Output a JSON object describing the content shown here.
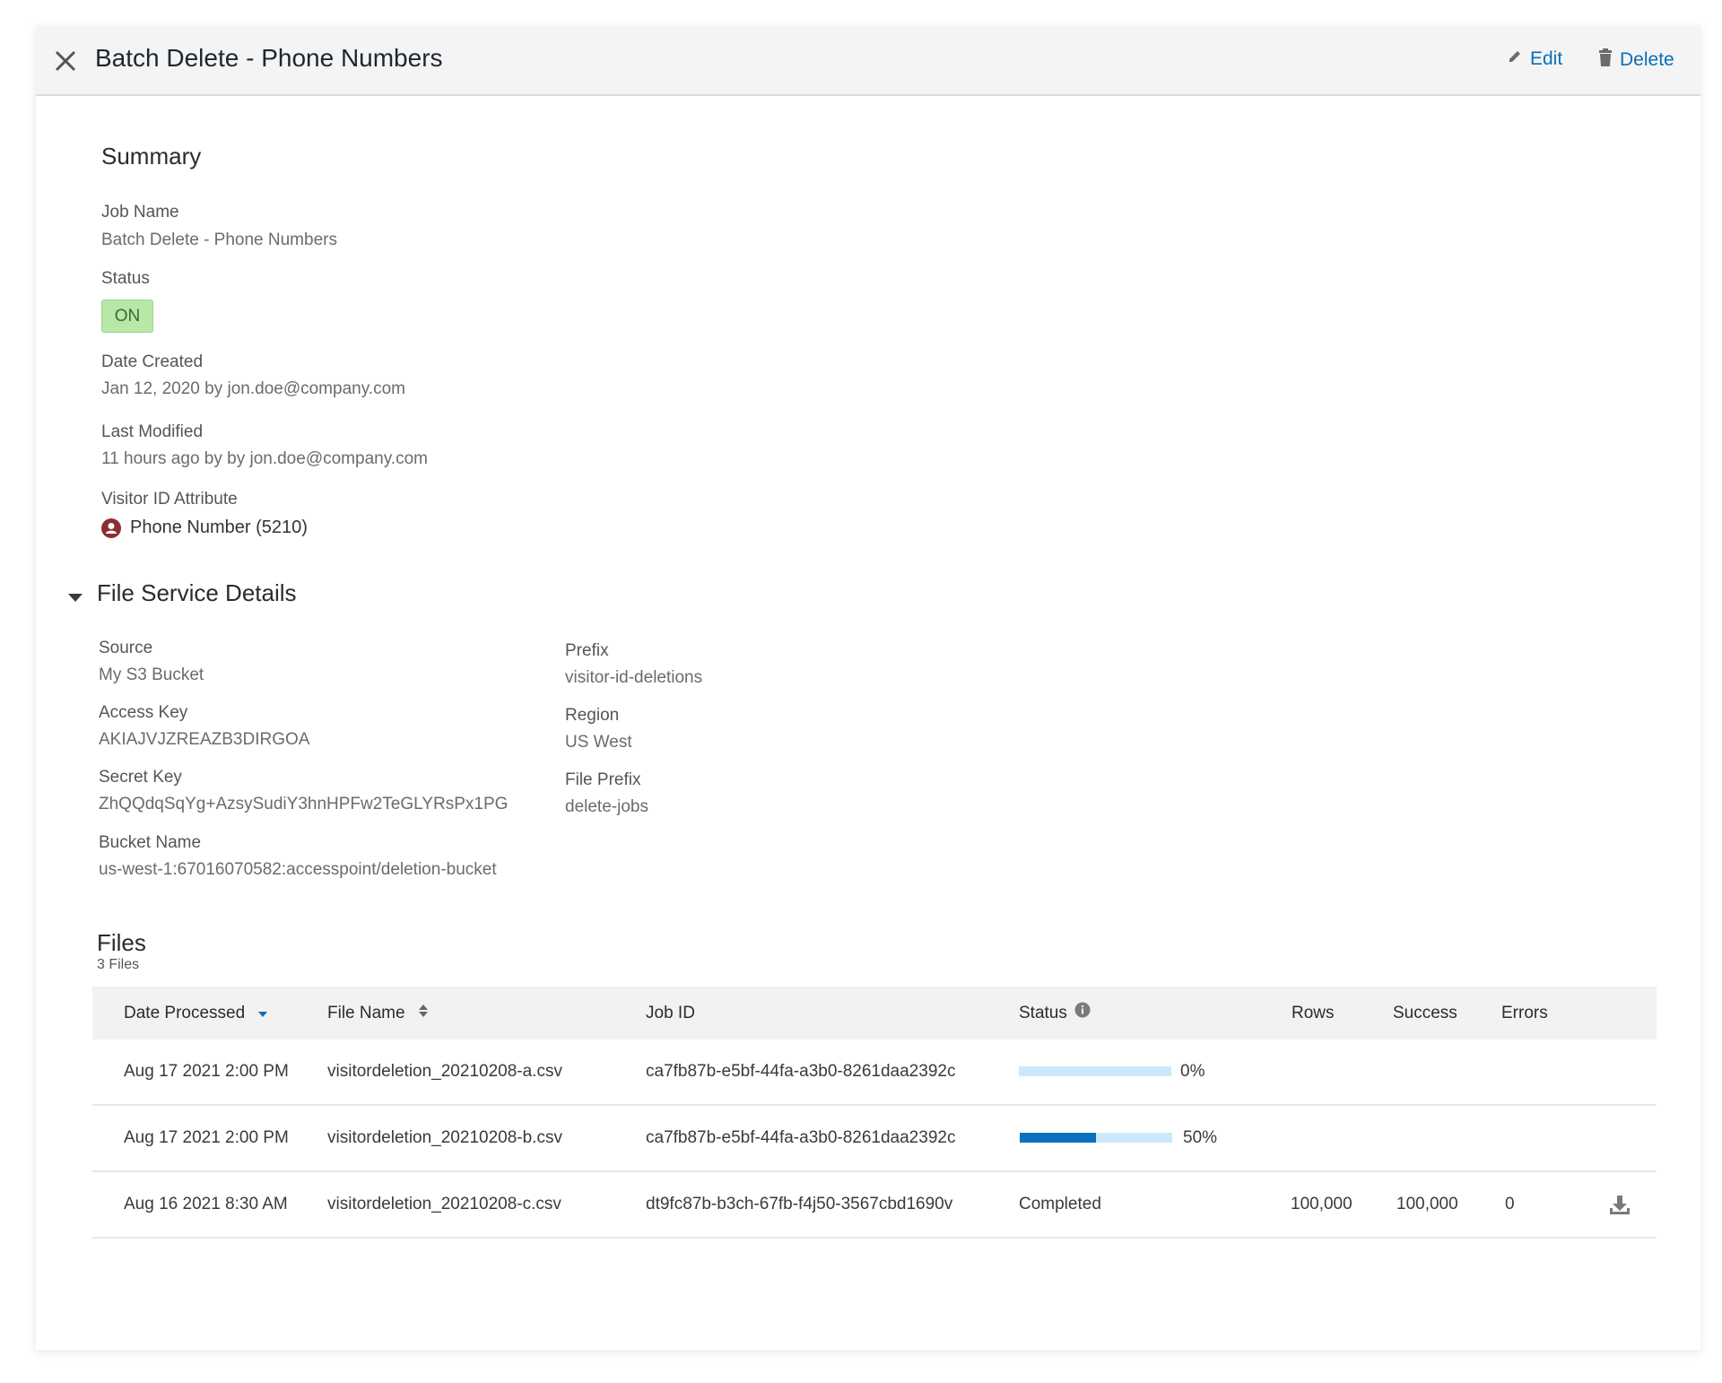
{
  "header": {
    "title": "Batch Delete - Phone Numbers",
    "edit_label": "Edit",
    "delete_label": "Delete"
  },
  "summary": {
    "title": "Summary",
    "job_name_label": "Job Name",
    "job_name_value": "Batch Delete - Phone Numbers",
    "status_label": "Status",
    "status_value": "ON",
    "date_created_label": "Date Created",
    "date_created_value": "Jan 12, 2020 by jon.doe@company.com",
    "last_modified_label": "Last Modified",
    "last_modified_value": "11 hours ago by by jon.doe@company.com",
    "visitor_id_label": "Visitor ID Attribute",
    "visitor_id_value": "Phone Number (5210)"
  },
  "file_service": {
    "title": "File Service Details",
    "source_label": "Source",
    "source_value": "My S3 Bucket",
    "access_key_label": "Access Key",
    "access_key_value": "AKIAJVJZREAZB3DIRGOA",
    "secret_key_label": "Secret Key",
    "secret_key_value": "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",
    "bucket_name_label": "Bucket Name",
    "bucket_name_value": "us-west-1:67016070582:accesspoint/deletion-bucket",
    "prefix_label": "Prefix",
    "prefix_value": "visitor-id-deletions",
    "region_label": "Region",
    "region_value": "US West",
    "file_prefix_label": "File Prefix",
    "file_prefix_value": "delete-jobs"
  },
  "files": {
    "title": "Files",
    "count_label": "3 Files",
    "columns": {
      "date_processed": "Date Processed",
      "file_name": "File Name",
      "job_id": "Job ID",
      "status": "Status",
      "rows": "Rows",
      "success": "Success",
      "errors": "Errors"
    },
    "rows": [
      {
        "date": "Aug 17 2021 2:00 PM",
        "file_name": "visitordeletion_20210208-a.csv",
        "job_id": "ca7fb87b-e5bf-44fa-a3b0-8261daa2392c",
        "progress": 0,
        "progress_label": "0%",
        "status": "",
        "rows": "",
        "success": "",
        "errors": ""
      },
      {
        "date": "Aug 17 2021 2:00 PM",
        "file_name": "visitordeletion_20210208-b.csv",
        "job_id": "ca7fb87b-e5bf-44fa-a3b0-8261daa2392c",
        "progress": 0.5,
        "progress_label": "50%",
        "status": "",
        "rows": "",
        "success": "",
        "errors": ""
      },
      {
        "date": "Aug 16 2021 8:30 AM",
        "file_name": "visitordeletion_20210208-c.csv",
        "job_id": "dt9fc87b-b3ch-67fb-f4j50-3567cbd1690v",
        "progress": null,
        "progress_label": "",
        "status": "Completed",
        "rows": "100,000",
        "success": "100,000",
        "errors": "0"
      }
    ]
  },
  "colors": {
    "accent": "#0a6eb7",
    "progress_track": "#cbe9fb",
    "progress_fill": "#0b72bf",
    "status_on_bg": "#b7e8a8"
  },
  "icons": {
    "close": "close-icon",
    "edit": "pencil-icon",
    "delete": "trash-icon",
    "visitor": "user-icon",
    "collapse": "caret-down-icon",
    "sort_desc": "sort-desc-icon",
    "sort": "sort-icon",
    "info": "info-icon",
    "download": "download-icon"
  }
}
